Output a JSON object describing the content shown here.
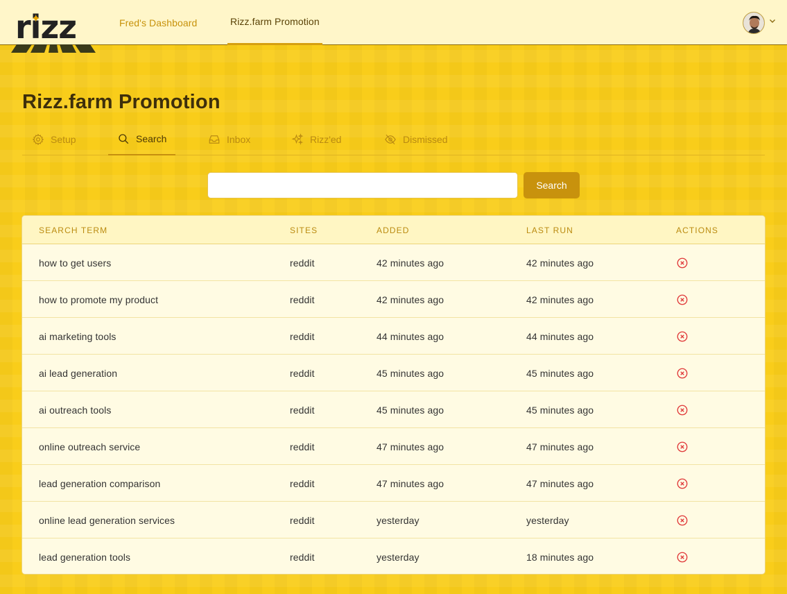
{
  "app": {
    "logo_text": "rizz"
  },
  "header": {
    "nav": [
      {
        "label": "Fred's Dashboard",
        "active": false
      },
      {
        "label": "Rizz.farm Promotion",
        "active": true
      }
    ],
    "avatar_icon": "user-avatar",
    "menu_icon": "chevron-down-icon"
  },
  "page": {
    "title": "Rizz.farm Promotion"
  },
  "tabs": [
    {
      "label": "Setup",
      "icon": "gear-icon",
      "active": false
    },
    {
      "label": "Search",
      "icon": "search-icon",
      "active": true
    },
    {
      "label": "Inbox",
      "icon": "inbox-icon",
      "active": false
    },
    {
      "label": "Rizz'ed",
      "icon": "sparkles-icon",
      "active": false
    },
    {
      "label": "Dismissed",
      "icon": "eye-off-icon",
      "active": false
    }
  ],
  "search": {
    "value": "",
    "placeholder": "",
    "button_label": "Search"
  },
  "table": {
    "columns": [
      "Search Term",
      "Sites",
      "Added",
      "Last Run",
      "Actions"
    ],
    "rows": [
      {
        "term": "how to get users",
        "sites": "reddit",
        "added": "42 minutes ago",
        "last_run": "42 minutes ago"
      },
      {
        "term": "how to promote my product",
        "sites": "reddit",
        "added": "42 minutes ago",
        "last_run": "42 minutes ago"
      },
      {
        "term": "ai marketing tools",
        "sites": "reddit",
        "added": "44 minutes ago",
        "last_run": "44 minutes ago"
      },
      {
        "term": "ai lead generation",
        "sites": "reddit",
        "added": "45 minutes ago",
        "last_run": "45 minutes ago"
      },
      {
        "term": "ai outreach tools",
        "sites": "reddit",
        "added": "45 minutes ago",
        "last_run": "45 minutes ago"
      },
      {
        "term": "online outreach service",
        "sites": "reddit",
        "added": "47 minutes ago",
        "last_run": "47 minutes ago"
      },
      {
        "term": "lead generation comparison",
        "sites": "reddit",
        "added": "47 minutes ago",
        "last_run": "47 minutes ago"
      },
      {
        "term": "online lead generation services",
        "sites": "reddit",
        "added": "yesterday",
        "last_run": "yesterday"
      },
      {
        "term": "lead generation tools",
        "sites": "reddit",
        "added": "yesterday",
        "last_run": "18 minutes ago"
      }
    ],
    "delete_icon": "x-circle-icon"
  },
  "colors": {
    "background": "#f9cd1a",
    "header_bg": "#fff6c9",
    "accent": "#c8920d",
    "danger": "#e0393a"
  }
}
